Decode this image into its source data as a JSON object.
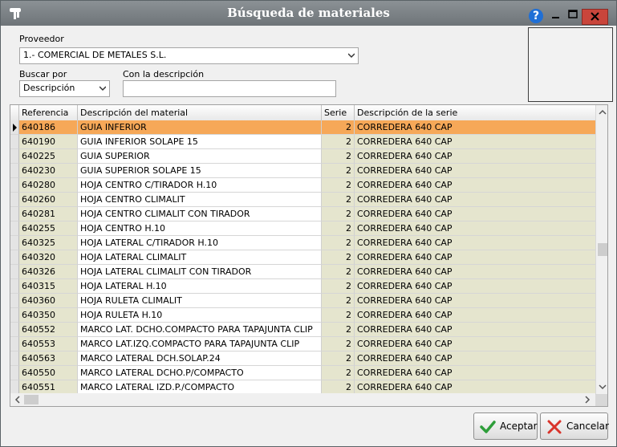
{
  "window": {
    "title": "Búsqueda de materiales",
    "help_label": "?"
  },
  "form": {
    "proveedor_label": "Proveedor",
    "proveedor_value": "1.- COMERCIAL DE METALES S.L.",
    "buscar_por_label": "Buscar por",
    "buscar_por_value": "Descripción",
    "con_desc_label": "Con la descripción",
    "con_desc_value": ""
  },
  "grid": {
    "columns": [
      "Referencia",
      "Descripción del material",
      "Serie",
      "Descripción de la serie"
    ],
    "rows": [
      [
        "640186",
        "GUIA INFERIOR",
        "2",
        "CORREDERA 640 CAP"
      ],
      [
        "640190",
        "GUIA INFERIOR SOLAPE 15",
        "2",
        "CORREDERA 640 CAP"
      ],
      [
        "640225",
        "GUIA SUPERIOR",
        "2",
        "CORREDERA 640 CAP"
      ],
      [
        "640230",
        "GUIA SUPERIOR SOLAPE 15",
        "2",
        "CORREDERA 640 CAP"
      ],
      [
        "640280",
        "HOJA CENTRO C/TIRADOR H.10",
        "2",
        "CORREDERA 640 CAP"
      ],
      [
        "640260",
        "HOJA CENTRO CLIMALIT",
        "2",
        "CORREDERA 640 CAP"
      ],
      [
        "640281",
        "HOJA CENTRO CLIMALIT CON TIRADOR",
        "2",
        "CORREDERA 640 CAP"
      ],
      [
        "640255",
        "HOJA CENTRO H.10",
        "2",
        "CORREDERA 640 CAP"
      ],
      [
        "640325",
        "HOJA LATERAL C/TIRADOR H.10",
        "2",
        "CORREDERA 640 CAP"
      ],
      [
        "640320",
        "HOJA LATERAL CLIMALIT",
        "2",
        "CORREDERA 640 CAP"
      ],
      [
        "640326",
        "HOJA LATERAL CLIMALIT CON TIRADOR",
        "2",
        "CORREDERA 640 CAP"
      ],
      [
        "640315",
        "HOJA LATERAL H.10",
        "2",
        "CORREDERA 640 CAP"
      ],
      [
        "640360",
        "HOJA RULETA CLIMALIT",
        "2",
        "CORREDERA 640 CAP"
      ],
      [
        "640350",
        "HOJA RULETA H.10",
        "2",
        "CORREDERA 640 CAP"
      ],
      [
        "640552",
        "MARCO LAT. DCHO.COMPACTO PARA TAPAJUNTA CLIP",
        "2",
        "CORREDERA 640 CAP"
      ],
      [
        "640553",
        "MARCO LAT.IZQ.COMPACTO PARA TAPAJUNTA CLIP",
        "2",
        "CORREDERA 640 CAP"
      ],
      [
        "640563",
        "MARCO LATERAL DCH.SOLAP.24",
        "2",
        "CORREDERA 640 CAP"
      ],
      [
        "640550",
        "MARCO LATERAL DCHO.P/COMPACTO",
        "2",
        "CORREDERA 640 CAP"
      ],
      [
        "640551",
        "MARCO LATERAL IZD.P./COMPACTO",
        "2",
        "CORREDERA 640 CAP"
      ]
    ],
    "selected_row": 0
  },
  "buttons": {
    "accept_label": "Aceptar",
    "cancel_label": "Cancelar"
  },
  "colors": {
    "selected_row": "#f6a858",
    "column_tint": "#e5e5ce",
    "accept_check": "#2e9e3a",
    "cancel_x": "#d9342b"
  },
  "icons": {
    "app": "hand-icon",
    "help": "help-icon",
    "minimize": "minimize-icon",
    "maximize": "maximize-icon",
    "close": "close-icon",
    "row_indicator": "triangle-right-icon",
    "accept": "check-icon",
    "cancel": "x-icon"
  }
}
